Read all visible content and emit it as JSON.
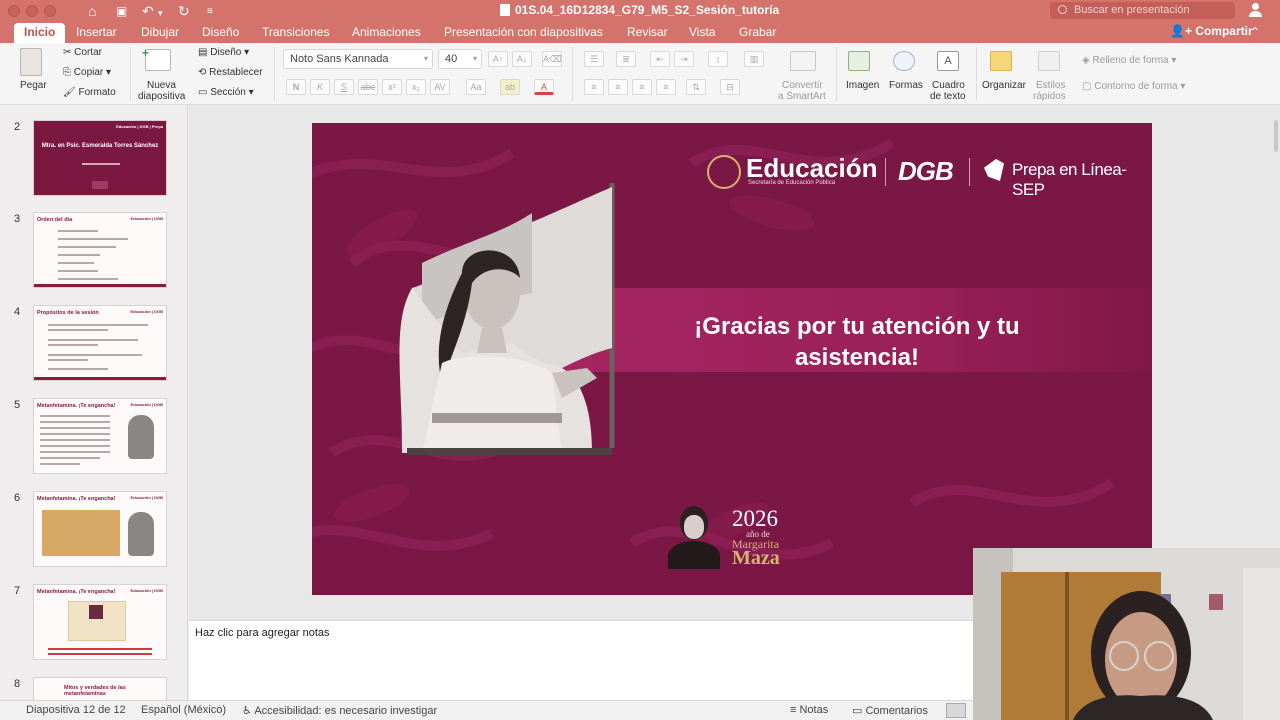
{
  "window": {
    "title": "01S.04_16D12834_G79_M5_S2_Sesión_tutoría",
    "search_placeholder": "Buscar en presentación"
  },
  "tabs": [
    "Inicio",
    "Insertar",
    "Dibujar",
    "Diseño",
    "Transiciones",
    "Animaciones",
    "Presentación con diapositivas",
    "Revisar",
    "Vista",
    "Grabar"
  ],
  "share_label": "Compartir",
  "ribbon": {
    "pegar": "Pegar",
    "cortar": "Cortar",
    "copiar": "Copiar",
    "formato": "Formato",
    "nueva_1": "Nueva",
    "nueva_2": "diapositiva",
    "diseno": "Diseño",
    "restablecer": "Restablecer",
    "seccion": "Sección",
    "font_name": "Noto Sans Kannada",
    "font_size": "40",
    "convertir_1": "Convertir",
    "convertir_2": "a SmartArt",
    "imagen": "Imagen",
    "formas": "Formas",
    "cuadro_1": "Cuadro",
    "cuadro_2": "de texto",
    "organizar": "Organizar",
    "estilos_1": "Estilos",
    "estilos_2": "rápidos",
    "relleno": "Relleno de forma",
    "contorno": "Contorno de forma"
  },
  "thumbnails": [
    {
      "num": "2",
      "title": "Mtra. en Psic. Esmeralda Torres Sánchez",
      "dark": true
    },
    {
      "num": "3",
      "title": "Orden del día"
    },
    {
      "num": "4",
      "title": "Propósitos de la sesión"
    },
    {
      "num": "5",
      "title": "Metanfetamina. ¡Te engancha!"
    },
    {
      "num": "6",
      "title": "Metanfetamina. ¡Te engancha!"
    },
    {
      "num": "7",
      "title": "Metanfetamina. ¡Te engancha!"
    },
    {
      "num": "8",
      "title": "Mitos y verdades de las metanfetaminas"
    }
  ],
  "slide": {
    "logo_main": "Educación",
    "logo_sub": "Secretaría de Educación Pública",
    "logo_dgb": "DGB",
    "logo_prepa": "Prepa en Línea-SEP",
    "message_line1": "¡Gracias por tu atención y tu",
    "message_line2": "asistencia!",
    "year": "2026",
    "year_sub": "año de",
    "year_name1": "Margarita",
    "year_name2": "Maza"
  },
  "notes_placeholder": "Haz clic para agregar notas",
  "status": {
    "slide_count": "Diapositiva 12 de 12",
    "language": "Español (México)",
    "accessibility": "Accesibilidad: es necesario investigar",
    "notes": "Notas",
    "comments": "Comentarios"
  },
  "colors": {
    "titlebar": "#d4736b",
    "slide_bg": "#7d1845",
    "accent": "#c0504d",
    "gold": "#d8b46a"
  }
}
